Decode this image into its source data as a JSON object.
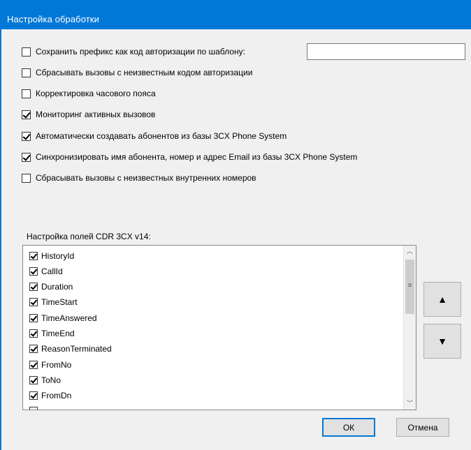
{
  "window": {
    "title": "Настройка обработки"
  },
  "options": [
    {
      "label": "Сохранить префикс как код авторизации по шаблону:",
      "checked": false
    },
    {
      "label": "Сбрасывать вызовы с неизвестным кодом авторизации",
      "checked": false
    },
    {
      "label": "Корректировка часового пояса",
      "checked": false
    },
    {
      "label": "Мониторинг активных вызовов",
      "checked": true
    },
    {
      "label": "Автоматически создавать абонентов из базы 3CX Phone System",
      "checked": true
    },
    {
      "label": "Синхронизировать имя абонента, номер и адрес Email из базы 3CX Phone System",
      "checked": true
    },
    {
      "label": "Сбрасывать вызовы с неизвестных внутренних номеров",
      "checked": false
    }
  ],
  "prefix_template": {
    "value": "",
    "placeholder": ""
  },
  "cdr": {
    "label": "Настройка полей CDR 3CX v14:",
    "fields": [
      {
        "label": "HistoryId",
        "checked": true
      },
      {
        "label": "CallId",
        "checked": true
      },
      {
        "label": "Duration",
        "checked": true
      },
      {
        "label": "TimeStart",
        "checked": true
      },
      {
        "label": "TimeAnswered",
        "checked": true
      },
      {
        "label": "TimeEnd",
        "checked": true
      },
      {
        "label": "ReasonTerminated",
        "checked": true
      },
      {
        "label": "FromNo",
        "checked": true
      },
      {
        "label": "ToNo",
        "checked": true
      },
      {
        "label": "FromDn",
        "checked": true
      }
    ]
  },
  "buttons": {
    "move_up": "▲",
    "move_down": "▼",
    "ok": "ОК",
    "cancel": "Отмена"
  },
  "icons": {
    "scroll_up": "chevron-up-icon",
    "scroll_down": "chevron-down-icon",
    "move_up": "triangle-up-icon",
    "move_down": "triangle-down-icon"
  },
  "colors": {
    "titlebar": "#0078d7",
    "dialog_bg": "#f0f0f0",
    "default_button_border": "#0078d7"
  }
}
